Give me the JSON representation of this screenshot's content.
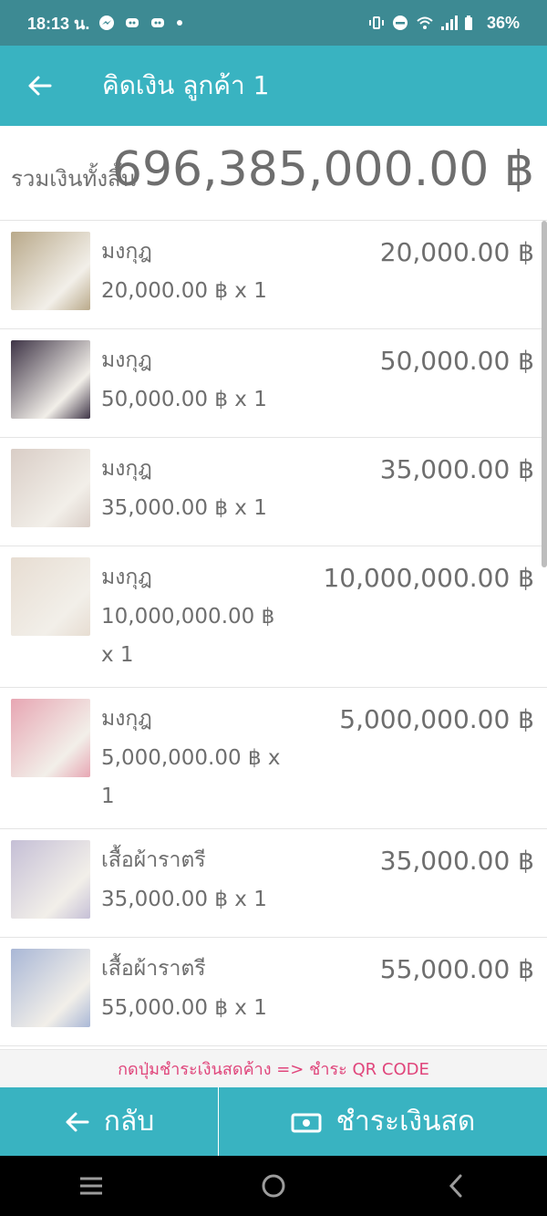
{
  "status_bar": {
    "time": "18:13 น.",
    "battery": "36%"
  },
  "app_bar": {
    "title": "คิดเงิน ลูกค้า 1"
  },
  "total": {
    "label": "รวมเงินทั้งสิ้น",
    "value": "696,385,000.00 ฿"
  },
  "items": [
    {
      "name": "มงกุฎ",
      "sub": "20,000.00 ฿   x 1",
      "price": "20,000.00 ฿",
      "height": 119,
      "thumb": "#b9a98a"
    },
    {
      "name": "มงกุฎ",
      "sub": "50,000.00 ฿   x 1",
      "price": "50,000.00 ฿",
      "height": 119,
      "thumb": "#3e3446"
    },
    {
      "name": "มงกุฎ",
      "sub": "35,000.00 ฿   x 1",
      "price": "35,000.00 ฿",
      "height": 119,
      "thumb": "#d9cdc6"
    },
    {
      "name": "มงกุฎ",
      "sub": "10,000,000.00 ฿   x 1",
      "price": "10,000,000.00 ฿",
      "height": 155,
      "thumb": "#e7ddd2"
    },
    {
      "name": "มงกุฎ",
      "sub": "5,000,000.00 ฿   x 1",
      "price": "5,000,000.00 ฿",
      "height": 155,
      "thumb": "#e7a6b3"
    },
    {
      "name": "เสื้อผ้าราตรี",
      "sub": "35,000.00 ฿   x 1",
      "price": "35,000.00 ฿",
      "height": 119,
      "thumb": "#c5bfd6"
    },
    {
      "name": "เสื้อผ้าราตรี",
      "sub": "55,000.00 ฿   x 1",
      "price": "55,000.00 ฿",
      "height": 119,
      "thumb": "#a9b7d6"
    }
  ],
  "hint": "กดปุ่มชำระเงินสดค้าง => ชำระ QR CODE",
  "buttons": {
    "back_label": "กลับ",
    "pay_label": "ชำระเงินสด"
  },
  "colors": {
    "accent": "#39b3c1",
    "status_bar": "#3d8a93",
    "hint_text": "#e0457b"
  }
}
